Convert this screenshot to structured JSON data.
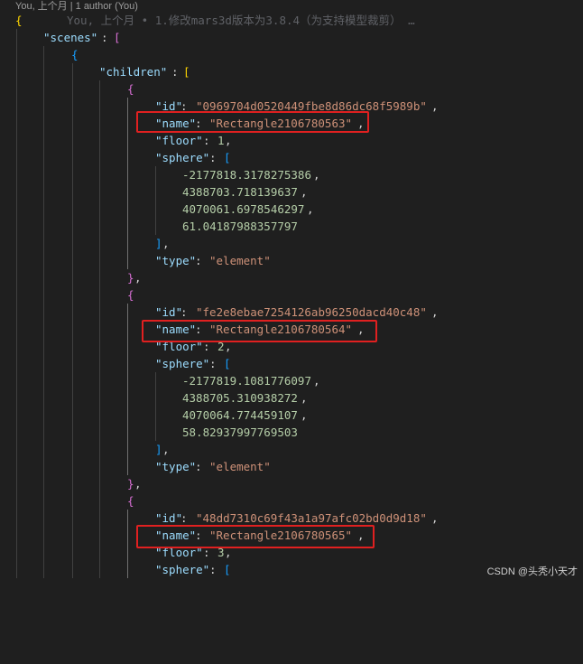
{
  "codelens": {
    "text": "You, 上个月 | 1 author (You)"
  },
  "blame": {
    "text": "You, 上个月 • 1.修改mars3d版本为3.8.4（为支持模型裁剪） …"
  },
  "keys": {
    "scenes": "\"scenes\"",
    "children": "\"children\"",
    "id": "\"id\"",
    "name": "\"name\"",
    "floor": "\"floor\"",
    "sphere": "\"sphere\"",
    "type": "\"type\""
  },
  "nodes": [
    {
      "id": "\"0969704d0520449fbe8d86dc68f5989b\"",
      "name": "\"Rectangle2106780563\"",
      "floor": "1",
      "sphere": [
        "-2177818.3178275386",
        "4388703.718139637",
        "4070061.6978546297",
        "61.04187988357797"
      ],
      "type": "\"element\""
    },
    {
      "id": "\"fe2e8ebae7254126ab96250dacd40c48\"",
      "name": "\"Rectangle2106780564\"",
      "floor": "2",
      "sphere": [
        "-2177819.1081776097",
        "4388705.310938272",
        "4070064.774459107",
        "58.82937997769503"
      ],
      "type": "\"element\""
    },
    {
      "id": "\"48dd7310c69f43a1a97afc02bd0d9d18\"",
      "name": "\"Rectangle2106780565\"",
      "floor": "3"
    }
  ],
  "watermark": "CSDN @头秃小天才",
  "colors": {
    "background": "#1f1f1f",
    "key": "#9cdcfe",
    "string": "#ce9178",
    "number": "#b5cea8",
    "highlight": "#e02020"
  }
}
